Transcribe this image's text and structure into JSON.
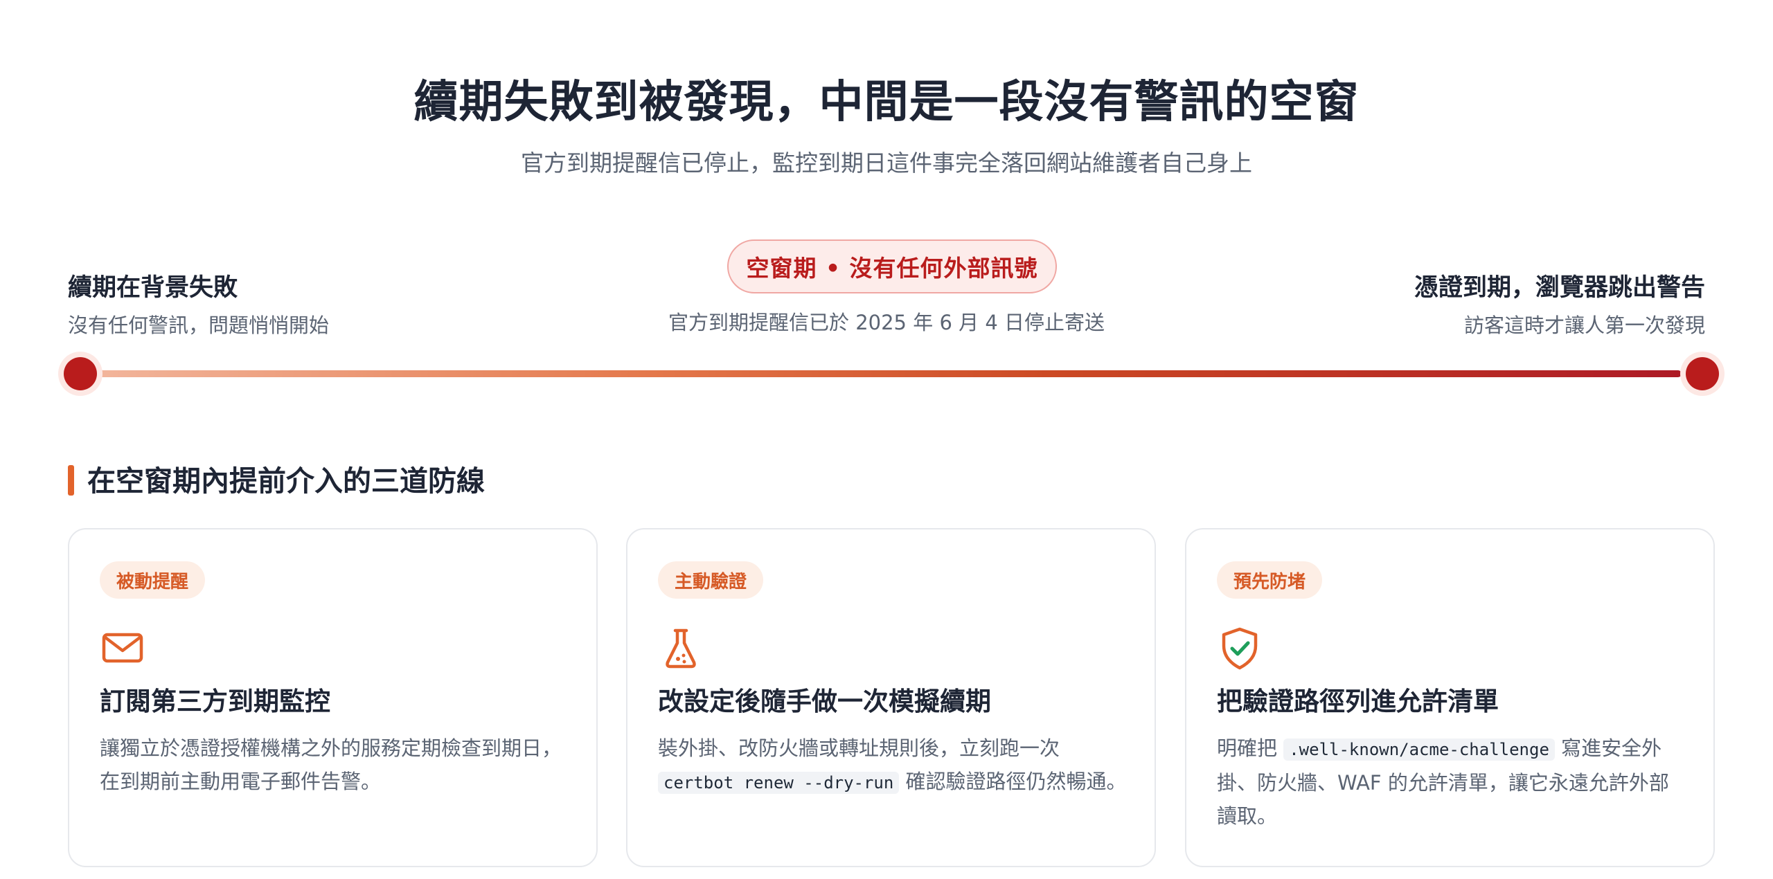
{
  "header": {
    "title": "續期失敗到被發現，中間是一段沒有警訊的空窗",
    "subtitle": "官方到期提醒信已停止，監控到期日這件事完全落回網站維護者自己身上"
  },
  "timeline": {
    "start": {
      "title": "續期在背景失敗",
      "desc": "沒有任何警訊，問題悄悄開始"
    },
    "gap": {
      "label": "空窗期 • 沒有任何外部訊號",
      "note": "官方到期提醒信已於 2025 年 6 月 4 日停止寄送"
    },
    "end": {
      "title": "憑證到期，瀏覽器跳出警告",
      "desc": "訪客這時才讓人第一次發現"
    }
  },
  "section": {
    "title": "在空窗期內提前介入的三道防線"
  },
  "cards": [
    {
      "badge": "被動提醒",
      "icon": "mail-icon",
      "title": "訂閱第三方到期監控",
      "body_1": "讓獨立於憑證授權機構之外的服務定期檢查到期日，",
      "body_2": "在到期前主動用電子郵件告警。"
    },
    {
      "badge": "主動驗證",
      "icon": "flask-icon",
      "title": "改設定後隨手做一次模擬續期",
      "body_1": "裝外掛、改防火牆或轉址規則後，立刻跑一次",
      "code": "certbot renew --dry-run",
      "body_2": " 確認驗證路徑仍然暢通。"
    },
    {
      "badge": "預先防堵",
      "icon": "shield-check-icon",
      "title": "把驗證路徑列進允許清單",
      "body_1": "明確把 ",
      "code": ".well-known/acme-challenge",
      "body_2": " 寫進安全外掛、防火牆、WAF 的允許清單，讓它永遠允許外部讀取。"
    }
  ],
  "colors": {
    "accent": "#e2632b",
    "danger": "#b91c1c",
    "success": "#1e9e5a",
    "text": "#1e2535",
    "muted": "#5b6473"
  }
}
